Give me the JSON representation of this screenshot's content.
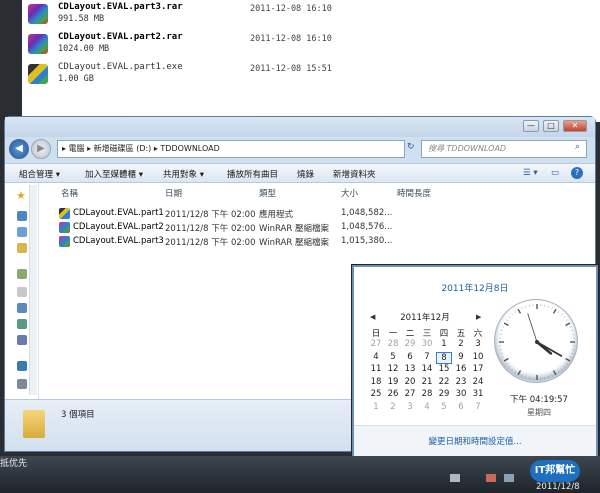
{
  "downloads": [
    {
      "name": "CDLayout.EVAL.part3.rar",
      "size": "991.58 MB",
      "date": "2011-12-08 16:10",
      "icon": "winrar-icon"
    },
    {
      "name": "CDLayout.EVAL.part2.rar",
      "size": "1024.00 MB",
      "date": "2011-12-08 16:10",
      "icon": "winrar-icon"
    },
    {
      "name": "CDLayout.EVAL.part1.exe",
      "size": "1.00 GB",
      "date": "2011-12-08 15:51",
      "icon": "winrar-sfx-icon"
    }
  ],
  "explorer": {
    "window_controls": {
      "minimize": "—",
      "maximize": "□",
      "close": "✕"
    },
    "address": "▸ 電腦 ▸ 新增磁碟區 (D:) ▸ TDDOWNLOAD",
    "search_placeholder": "搜尋 TDDOWNLOAD",
    "toolbar": [
      "組合管理 ▾",
      "加入至媒體櫃 ▾",
      "共用對象 ▾",
      "播放所有曲目",
      "燒錄",
      "新增資料夾"
    ],
    "columns": [
      "名稱",
      "日期",
      "類型",
      "大小",
      "時間長度"
    ],
    "files": [
      {
        "name": "CDLayout.EVAL.part1",
        "date": "2011/12/8 下午 02:00",
        "type": "應用程式",
        "size": "1,048,582..."
      },
      {
        "name": "CDLayout.EVAL.part2",
        "date": "2011/12/8 下午 02:00",
        "type": "WinRAR 壓縮檔案",
        "size": "1,048,576..."
      },
      {
        "name": "CDLayout.EVAL.part3",
        "date": "2011/12/8 下午 02:00",
        "type": "WinRAR 壓縮檔案",
        "size": "1,015,380..."
      }
    ],
    "status": "3 個項目"
  },
  "clock": {
    "date_title": "2011年12月8日",
    "month_label": "2011年12月",
    "weekdays": [
      "日",
      "一",
      "二",
      "三",
      "四",
      "五",
      "六"
    ],
    "days": [
      [
        "27",
        "28",
        "29",
        "30",
        "1",
        "2",
        "3"
      ],
      [
        "4",
        "5",
        "6",
        "7",
        "8",
        "9",
        "10"
      ],
      [
        "11",
        "12",
        "13",
        "14",
        "15",
        "16",
        "17"
      ],
      [
        "18",
        "19",
        "20",
        "21",
        "22",
        "23",
        "24"
      ],
      [
        "25",
        "26",
        "27",
        "28",
        "29",
        "30",
        "31"
      ],
      [
        "1",
        "2",
        "3",
        "4",
        "5",
        "6",
        "7"
      ]
    ],
    "today": "8",
    "time": "下午 04:19:57",
    "day_of_week": "星期四",
    "hands": {
      "hour": 4,
      "minute": 19,
      "second": 57
    },
    "link": "變更日期和時間設定值..."
  },
  "taskbar": {
    "left_text": "抵优先",
    "date": "2011/12/8",
    "logo": "IT邦幫忙"
  },
  "colors": {
    "accent": "#1d5fa8",
    "window_frame": "#cfe0f0",
    "taskbar": "#2a3038"
  }
}
